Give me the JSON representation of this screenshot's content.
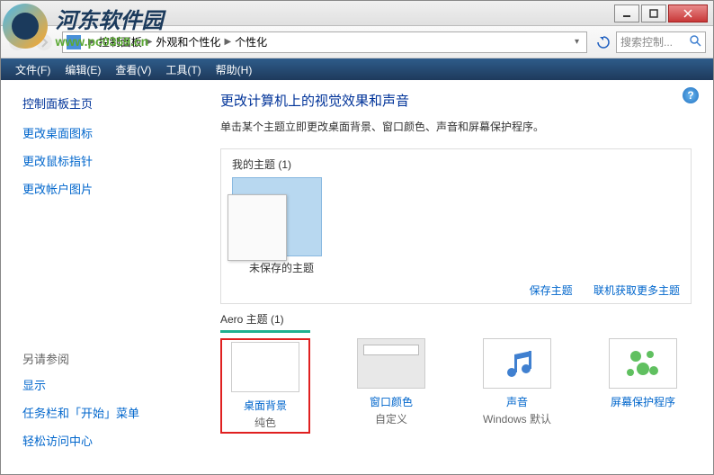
{
  "watermark": {
    "cn": "河东软件园",
    "url": "www.pc0359.cn"
  },
  "breadcrumb": {
    "items": [
      "控制面板",
      "外观和个性化",
      "个性化"
    ]
  },
  "search": {
    "placeholder": "搜索控制..."
  },
  "menu": {
    "file": "文件(F)",
    "edit": "编辑(E)",
    "view": "查看(V)",
    "tools": "工具(T)",
    "help": "帮助(H)"
  },
  "sidebar": {
    "home": "控制面板主页",
    "links": [
      "更改桌面图标",
      "更改鼠标指针",
      "更改帐户图片"
    ],
    "see_also_title": "另请参阅",
    "see_also": [
      "显示",
      "任务栏和「开始」菜单",
      "轻松访问中心"
    ]
  },
  "main": {
    "title": "更改计算机上的视觉效果和声音",
    "desc": "单击某个主题立即更改桌面背景、窗口颜色、声音和屏幕保护程序。"
  },
  "my_themes": {
    "title": "我的主题 (1)",
    "item_label": "未保存的主题",
    "save_link": "保存主题",
    "online_link": "联机获取更多主题"
  },
  "aero": {
    "title": "Aero 主题 (1)"
  },
  "bottom": {
    "desktop_bg": {
      "label": "桌面背景",
      "sublabel": "纯色"
    },
    "window_color": {
      "label": "窗口颜色",
      "sublabel": "自定义"
    },
    "sound": {
      "label": "声音",
      "sublabel": "Windows 默认"
    },
    "screensaver": {
      "label": "屏幕保护程序",
      "sublabel": ""
    }
  }
}
